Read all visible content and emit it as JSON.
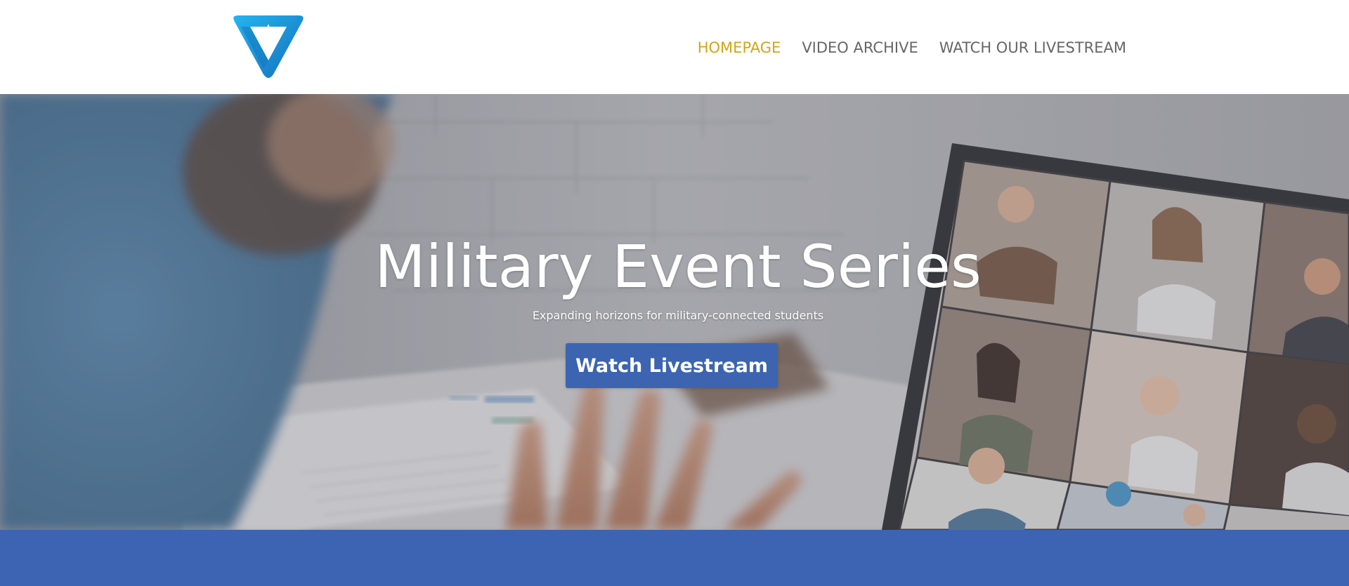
{
  "header": {
    "logo_icon": "triangle-star-logo",
    "nav": [
      {
        "label": "HOMEPAGE",
        "active": true
      },
      {
        "label": "VIDEO ARCHIVE",
        "active": false
      },
      {
        "label": "WATCH OUR LIVESTREAM",
        "active": false
      }
    ]
  },
  "hero": {
    "title": "Military Event Series",
    "subtitle": "Expanding horizons for military-connected students",
    "button_label": "Watch Livestream",
    "background_image": "person on video call with laptop showing participant grid"
  },
  "colors": {
    "nav_active": "#d4a419",
    "nav_default": "#666666",
    "button_bg": "#3c64b1",
    "band_bg": "#3d64b2",
    "logo_blue": "#1e8fd6"
  }
}
